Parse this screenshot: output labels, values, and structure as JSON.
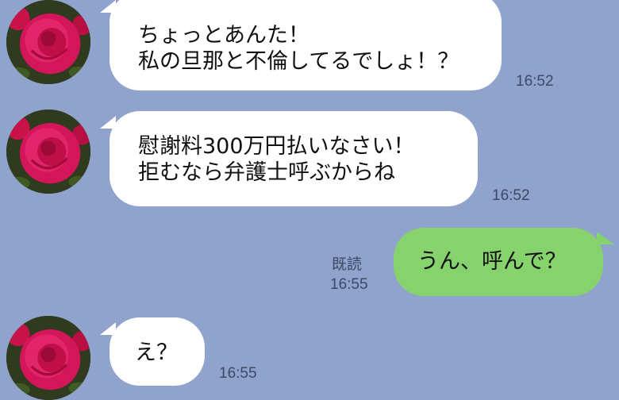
{
  "colors": {
    "background": "#8fa3cc",
    "incoming_bubble": "#ffffff",
    "outgoing_bubble": "#86d36e",
    "meta_text": "#3c4866"
  },
  "messages": [
    {
      "sender": "other",
      "avatar": "rose-avatar",
      "lines": [
        "ちょっとあんた！",
        "私の旦那と不倫してるでしょ！？"
      ],
      "time": "16:52"
    },
    {
      "sender": "other",
      "avatar": "rose-avatar",
      "lines": [
        "慰謝料300万円払いなさい！",
        "拒むなら弁護士呼ぶからね"
      ],
      "time": "16:52"
    },
    {
      "sender": "me",
      "lines": [
        "うん、呼んで？"
      ],
      "read": "既読",
      "time": "16:55"
    },
    {
      "sender": "other",
      "avatar": "rose-avatar",
      "lines": [
        "え？"
      ],
      "time": "16:55"
    }
  ]
}
